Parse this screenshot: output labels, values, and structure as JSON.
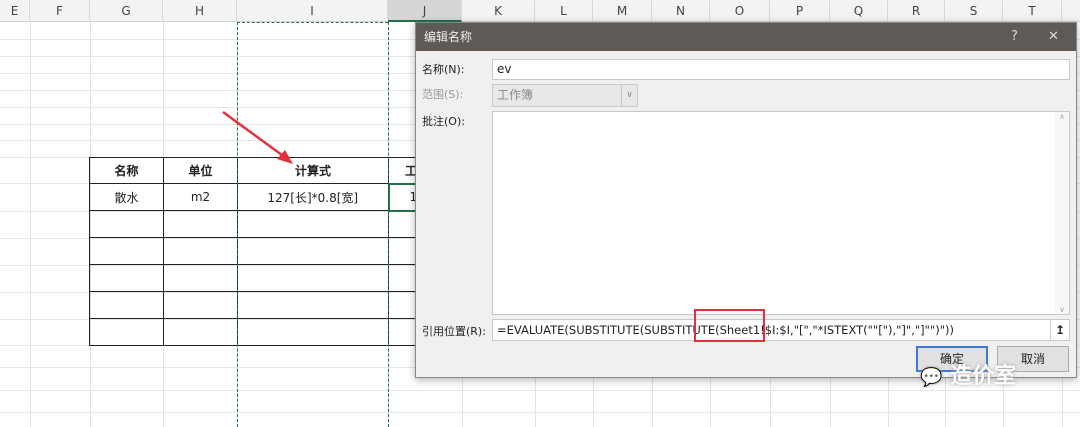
{
  "columns": [
    "E",
    "F",
    "G",
    "H",
    "I",
    "J",
    "K",
    "L",
    "M",
    "N",
    "O",
    "P",
    "Q",
    "R",
    "S",
    "T"
  ],
  "table": {
    "headers": [
      "名称",
      "单位",
      "计算式",
      "工"
    ],
    "rows": [
      [
        "散水",
        "m2",
        "127[长]*0.8[宽]",
        "1"
      ]
    ]
  },
  "dialog": {
    "title": "编辑名称",
    "help": "?",
    "close": "✕",
    "name_label": "名称(N):",
    "name_value": "ev",
    "scope_label": "范围(S):",
    "scope_value": "工作簿",
    "comment_label": "批注(O):",
    "comment_value": "",
    "ref_label": "引用位置(R):",
    "ref_value": "=EVALUATE(SUBSTITUTE(SUBSTITUTE(Sheet1!$I:$I,\"[\",\"*ISTEXT(\"\"[\"),\"]\",\"]\"\")\"))",
    "ok": "确定",
    "cancel": "取消"
  },
  "watermark": "造价室"
}
